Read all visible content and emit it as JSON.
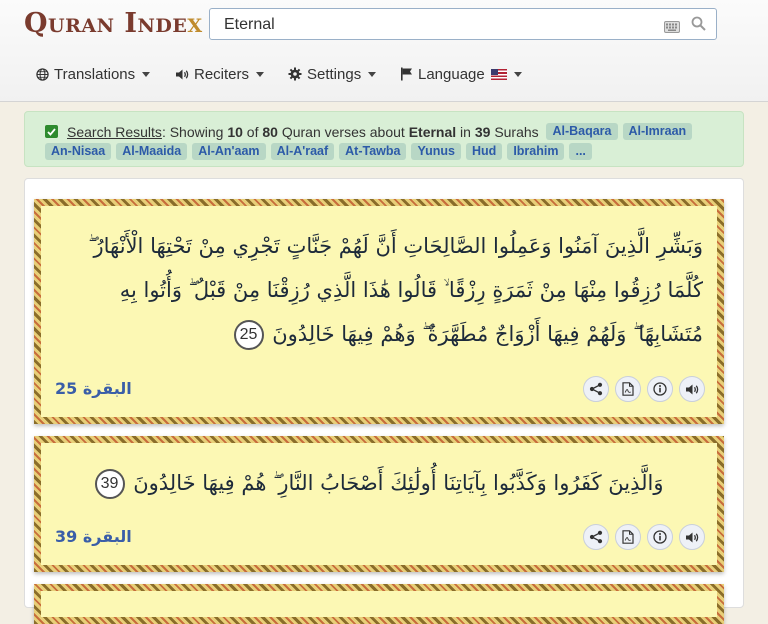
{
  "logo": {
    "main": "Quran Inde",
    "x": "x"
  },
  "search": {
    "value": "Eternal"
  },
  "nav": {
    "translations": "Translations",
    "reciters": "Reciters",
    "settings": "Settings",
    "language": "Language"
  },
  "results": {
    "link": "Search Results",
    "showing": "Showing",
    "count": "10",
    "of": "of",
    "total": "80",
    "middle": "Quran verses about",
    "term": "Eternal",
    "in": "in",
    "surahs_count": "39",
    "surahs_word": "Surahs",
    "tags_line1": [
      "Al-Baqara",
      "Al-Imraan"
    ],
    "tags_line2": [
      "An-Nisaa",
      "Al-Maaida",
      "Al-An'aam",
      "Al-A'raaf",
      "At-Tawba",
      "Yunus",
      "Hud",
      "Ibrahim",
      "..."
    ]
  },
  "verses": [
    {
      "text": "وَبَشِّرِ الَّذِينَ آمَنُوا وَعَمِلُوا الصَّالِحَاتِ أَنَّ لَهُمْ جَنَّاتٍ تَجْرِي مِنْ تَحْتِهَا الْأَنْهَارُ ۖ كُلَّمَا رُزِقُوا مِنْهَا مِنْ ثَمَرَةٍ رِزْقًا ۙ قَالُوا هَٰذَا الَّذِي رُزِقْنَا مِنْ قَبْلُ ۖ وَأُتُوا بِهِ مُتَشَابِهًا ۖ وَلَهُمْ فِيهَا أَزْوَاجٌ مُطَهَّرَةٌ ۖ وَهُمْ فِيهَا خَالِدُونَ",
      "number": "25",
      "surah": "البقرة",
      "ref_number": "25"
    },
    {
      "text": "وَالَّذِينَ كَفَرُوا وَكَذَّبُوا بِآيَاتِنَا أُولَٰئِكَ أَصْحَابُ النَّارِ ۖ هُمْ فِيهَا خَالِدُونَ",
      "number": "39",
      "surah": "البقرة",
      "ref_number": "39"
    }
  ],
  "colors": {
    "brand": "#7a3b2e",
    "accent": "#c08b2d",
    "link": "#3a5ea8",
    "card": "#fcf8b4",
    "results_bg": "#d9efd6"
  },
  "icons": [
    "globe-icon",
    "speaker-icon",
    "gear-icon",
    "flag-icon",
    "keyboard-icon",
    "search-icon",
    "share-icon",
    "pdf-icon",
    "info-icon",
    "audio-icon"
  ]
}
